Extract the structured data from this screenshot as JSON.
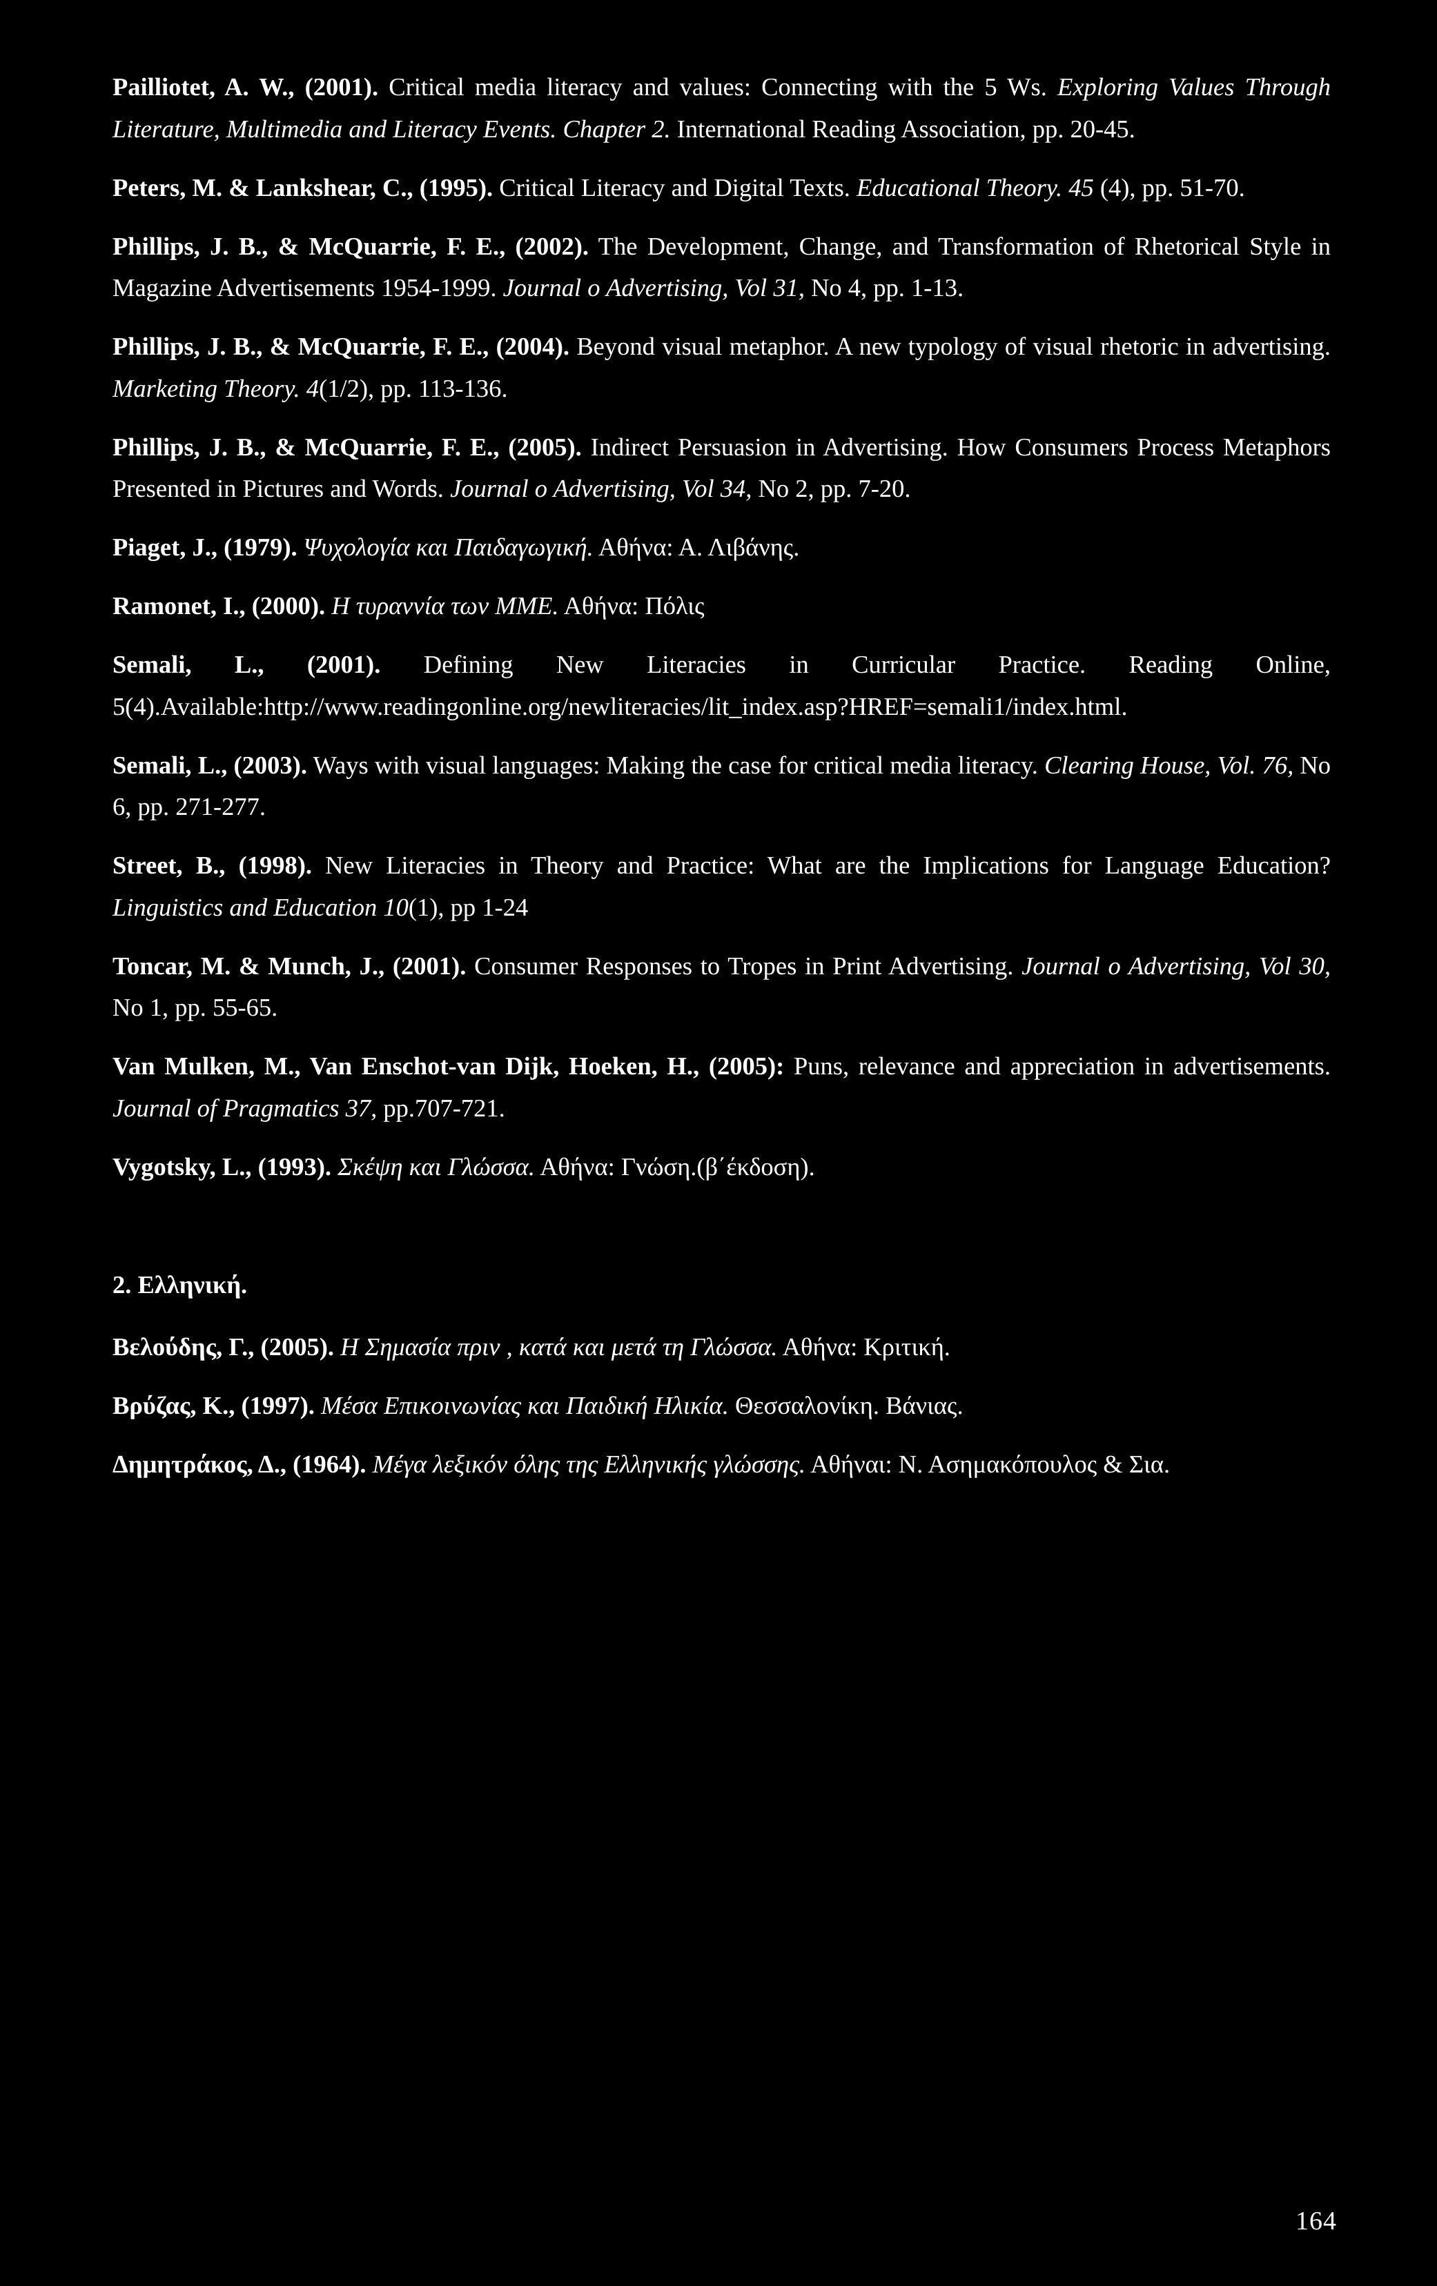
{
  "page": {
    "folio": "164",
    "background_color": "#000000",
    "text_color": "#ffffff"
  },
  "sections": [
    {
      "id": "english-references",
      "heading": null,
      "entries": [
        {
          "id": "pailliotet-2001",
          "author_bold": "Pailliotet, A. W., (2001).",
          "rest_1": " Critical media literacy and values: Connecting with the 5 Ws. ",
          "title_italic": "Exploring Values Through Literature, Multimedia and Literacy Events. Chapter 2.",
          "rest_2": " International Reading Association, pp. 20-45."
        },
        {
          "id": "peters-lankshear-1995",
          "author_bold": "Peters, M. & Lankshear, C., (1995).",
          "rest_1": " Critical Literacy and Digital Texts. ",
          "title_italic": "Educational Theory. 45",
          "rest_2": " (4), pp. 51-70."
        },
        {
          "id": "phillips-mcquarrie-2002",
          "author_bold": "Phillips, J. B., & McQuarrie, F. E., (2002).",
          "rest_1": " The Development, Change, and Transformation of Rhetorical Style in Magazine Advertisements 1954-1999. ",
          "title_italic": "Journal o Advertising, Vol 31,",
          "rest_2": " No 4, pp. 1-13."
        },
        {
          "id": "phillips-mcquarrie-2004",
          "author_bold": "Phillips, J. B., & McQuarrie, F. E., (2004).",
          "rest_1": " Beyond visual metaphor. A new typology of visual rhetoric in advertising. ",
          "title_italic": "Marketing Theory. 4",
          "rest_2": "(1/2), pp. 113-136."
        },
        {
          "id": "phillips-mcquarrie-2005",
          "author_bold": "Phillips, J. B., & McQuarrie, F. E., (2005).",
          "rest_1": " Indirect Persuasion in Advertising. How Consumers Process Metaphors Presented in Pictures and Words.  ",
          "title_italic": "Journal o Advertising, Vol 34,",
          "rest_2": " No 2, pp. 7-20."
        },
        {
          "id": "piaget-1979",
          "author_bold": "Piaget, J., (1979).",
          "rest_1": " ",
          "title_italic": "Ψυχολογία και Παιδαγωγική.",
          "rest_2": " Αθήνα: Α. Λιβάνης."
        },
        {
          "id": "ramonet-2000",
          "author_bold": "Ramonet, I., (2000).",
          "rest_1": " ",
          "title_italic": "Η τυραννία των ΜΜΕ.",
          "rest_2": " Αθήνα: Πόλις"
        },
        {
          "id": "semali-2001",
          "author_bold": "Semali, L., (2001).",
          "rest_1": " Defining New Literacies in Curricular Practice. Reading Online, 5(4).Available:http://www.readingonline.org/newliteracies/lit_index.asp?HREF=semali1/index.html.",
          "title_italic": "",
          "rest_2": ""
        },
        {
          "id": "semali-2003",
          "author_bold": "Semali, L., (2003).",
          "rest_1": " Ways with visual languages: Making the case for critical media literacy. ",
          "title_italic": "Clearing House, Vol. 76,",
          "rest_2": " No 6, pp. 271-277."
        },
        {
          "id": "street-1998",
          "author_bold": "Street, B., (1998).",
          "rest_1": " New Literacies in Theory and Practice: What are the Implications for Language Education? ",
          "title_italic": "Linguistics and Education 10",
          "rest_2": "(1), pp 1-24"
        },
        {
          "id": "toncar-munch-2001",
          "author_bold": "Toncar, M. & Munch, J., (2001).",
          "rest_1": " Consumer Responses to Tropes in Print Advertising. ",
          "title_italic": "Journal o Advertising, Vol 30,",
          "rest_2": " No 1, pp. 55-65."
        },
        {
          "id": "van-mulken-2005",
          "author_bold": "Van Mulken, M., Van Enschot-van Dijk, Hoeken, H., (2005):",
          "rest_1": " Puns, relevance and appreciation in advertisements. ",
          "title_italic": "Journal of Pragmatics 37,",
          "rest_2": " pp.707-721."
        },
        {
          "id": "vygotsky-1993",
          "author_bold": "Vygotsky, L., (1993).",
          "rest_1": " ",
          "title_italic": "Σκέψη και Γλώσσα.",
          "rest_2": " Αθήνα: Γνώση.(β΄έκδοση)."
        }
      ]
    },
    {
      "id": "greek-references",
      "heading": "2. Ελληνική.",
      "entries": [
        {
          "id": "veloudis-2005",
          "author_bold": "Βελούδης, Γ., (2005).",
          "rest_1": " ",
          "title_italic": "Η Σημασία πριν , κατά και μετά τη Γλώσσα.",
          "rest_2": " Αθήνα: Κριτική."
        },
        {
          "id": "vryzas-1997",
          "author_bold": "Βρύζας, Κ., (1997).",
          "rest_1": " ",
          "title_italic": "Μέσα Επικοινωνίας και Παιδική Ηλικία.",
          "rest_2": " Θεσσαλονίκη. Βάνιας."
        },
        {
          "id": "dimitrakos-1964",
          "author_bold": "Δημητράκος, Δ., (1964).",
          "rest_1": " ",
          "title_italic": "Μέγα λεξικόν όλης της Ελληνικής γλώσσης.",
          "rest_2": " Αθήναι: Ν. Ασημακόπουλος & Σια."
        }
      ]
    }
  ]
}
